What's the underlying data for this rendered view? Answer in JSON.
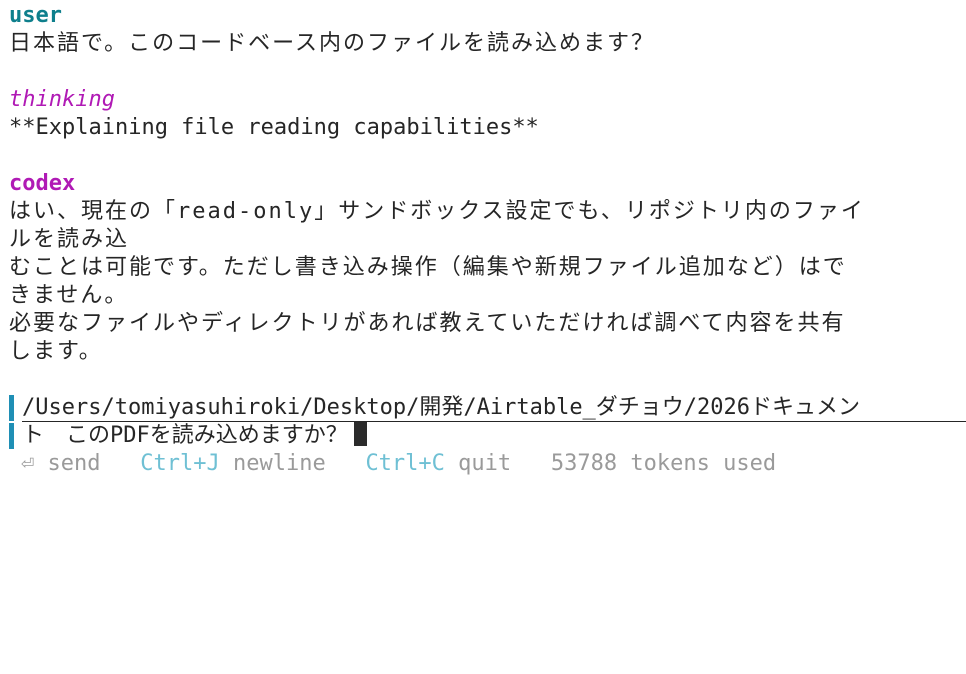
{
  "transcript": {
    "user_label": "user",
    "user_message": "日本語で。このコードベース内のファイルを読み込めます？",
    "thinking_label": "thinking",
    "thinking_message": "**Explaining file reading capabilities**",
    "codex_label": "codex",
    "codex_lines": [
      "はい、現在の「read-only」サンドボックス設定でも、リポジトリ内のファイ",
      "ルを読み込",
      "むことは可能です。ただし書き込み操作（編集や新規ファイル追加など）はで",
      "きません。",
      "必要なファイルやディレクトリがあれば教えていただければ調べて内容を共有",
      "します。"
    ]
  },
  "composer": {
    "line1": "/Users/tomiyasuhiroki/Desktop/開発/Airtable_ダチョウ/2026ドキュメン",
    "line2": "ト　このPDFを読み込めますか？"
  },
  "footer": {
    "send_icon": "⏎",
    "send_label": "send",
    "newline_key": "Ctrl+J",
    "newline_label": "newline",
    "quit_key": "Ctrl+C",
    "quit_label": "quit",
    "tokens_text": "53788 tokens used"
  },
  "colors": {
    "user": "#0e7f8c",
    "thinking": "#b01ab5",
    "codex": "#b01ab5",
    "composer_bar": "#1f8fb5",
    "hint_key": "#6fc0d4",
    "hint_text": "#9a9a9a"
  }
}
